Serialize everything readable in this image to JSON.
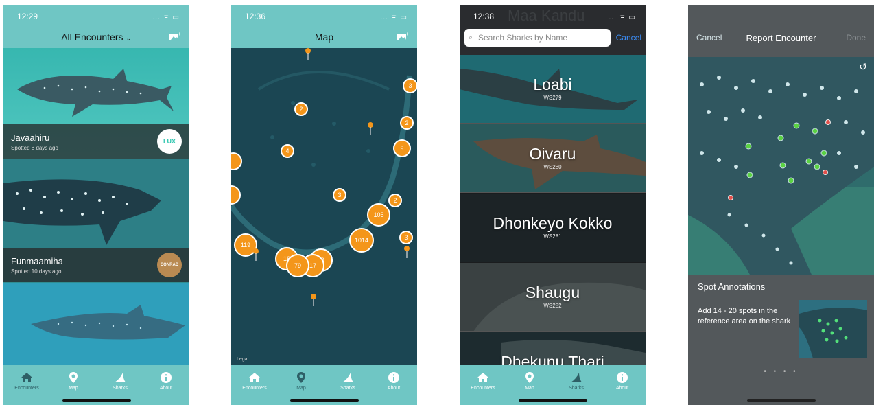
{
  "screens": {
    "encounters": {
      "status_time": "12:29",
      "title": "All Encounters",
      "cards": [
        {
          "name": "Javaahiru",
          "spotted": "Spotted 8 days ago",
          "logo_text": "LUX"
        },
        {
          "name": "Funmaamiha",
          "spotted": "Spotted 10 days ago",
          "logo_text": "CONRAD"
        }
      ]
    },
    "map": {
      "status_time": "12:36",
      "title": "Map",
      "legal": "Legal",
      "clusters": [
        "3",
        "2",
        "2",
        "9",
        "4",
        "3",
        "2",
        "105",
        "1014",
        "3",
        "119",
        "18",
        "79",
        "17",
        "59"
      ]
    },
    "sharks": {
      "status_time": "12:38",
      "header_faded": "Maa Kandu",
      "search_placeholder": "Search Sharks by Name",
      "cancel": "Cancel",
      "list": [
        {
          "name": "Loabi",
          "id": "WS279"
        },
        {
          "name": "Oivaru",
          "id": "WS280"
        },
        {
          "name": "Dhonkeyo Kokko",
          "id": "WS281"
        },
        {
          "name": "Shaugu",
          "id": "WS282"
        },
        {
          "name": "Dhekunu Thari",
          "id": ""
        }
      ]
    },
    "report": {
      "cancel": "Cancel",
      "title": "Report Encounter",
      "done": "Done",
      "section_title": "Spot Annotations",
      "description": "Add 14 - 20 spots in the reference area on the shark",
      "page_dots": "• • • •"
    }
  },
  "tabs": [
    "Encounters",
    "Map",
    "Sharks",
    "About"
  ],
  "colors": {
    "teal": "#6fc6c4",
    "cluster_orange": "#f4961a",
    "ios_blue": "#3b8cf5",
    "dark_panel": "#53585b",
    "active_tab": "#2e5f66"
  }
}
